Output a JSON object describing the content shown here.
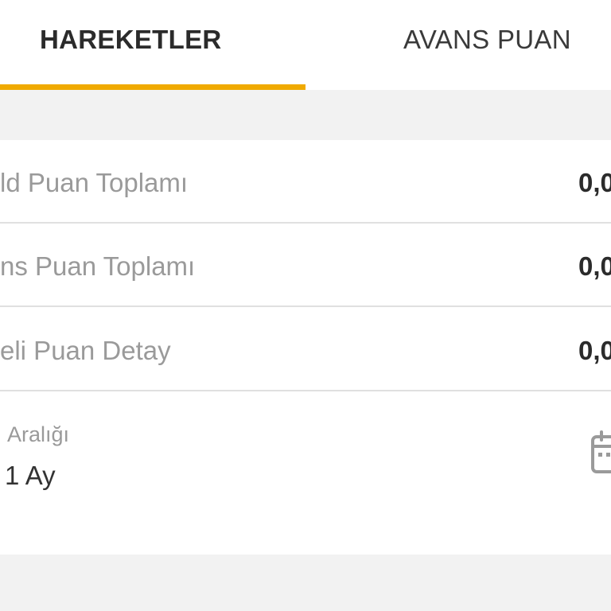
{
  "tabs": {
    "active": {
      "label": "HAREKETLER"
    },
    "inactive": {
      "label": "AVANS PUAN"
    },
    "indicator_color": "#f0aa00"
  },
  "summary": {
    "rows": [
      {
        "label": "ld Puan Toplamı",
        "value": "0,0"
      },
      {
        "label": "ns Puan Toplamı",
        "value": "0,0"
      },
      {
        "label": "eli Puan Detay",
        "value": "0,0"
      }
    ]
  },
  "date_filter": {
    "caption": "Aralığı",
    "value": "1 Ay",
    "icon": "calendar-icon"
  }
}
